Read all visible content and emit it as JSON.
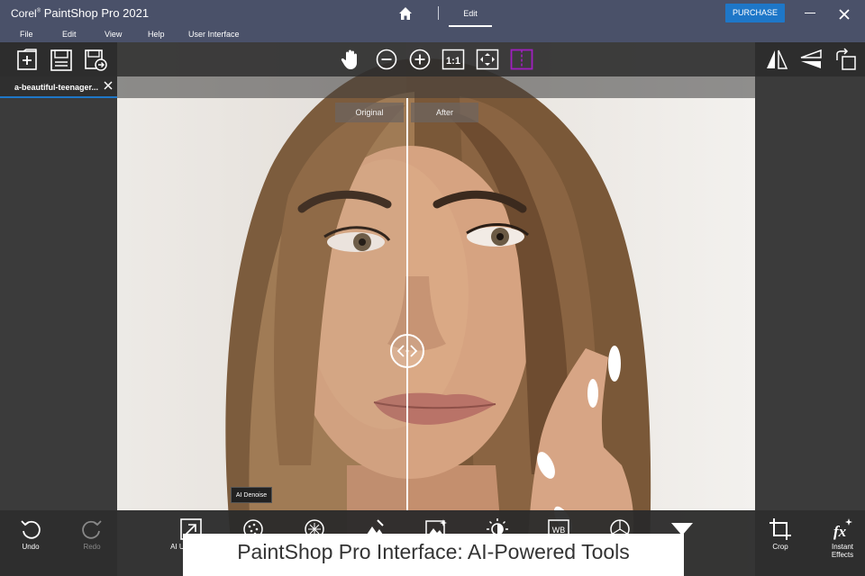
{
  "titlebar": {
    "app_prefix": "Corel",
    "app_name": "PaintShop Pro 2021",
    "tab_edit": "Edit",
    "purchase_label": "PURCHASE"
  },
  "menu": {
    "items": [
      "File",
      "Edit",
      "View",
      "Help",
      "User Interface"
    ]
  },
  "file_tab": {
    "name": "a-beautiful-teenager..."
  },
  "compare": {
    "original_label": "Original",
    "after_label": "After"
  },
  "tooltip": {
    "text": "AI Denoise"
  },
  "bottom": {
    "undo_label": "Undo",
    "redo_label": "Redo",
    "upsample_label": "AI Upsample",
    "crop_label": "Crop",
    "instant_effects_label": "Instant Effects"
  },
  "caption": {
    "text": "PaintShop Pro Interface: AI-Powered Tools"
  },
  "colors": {
    "titlebar_bg": "#4a5169",
    "accent": "#1e77c8",
    "compare_active": "#a020c0"
  }
}
